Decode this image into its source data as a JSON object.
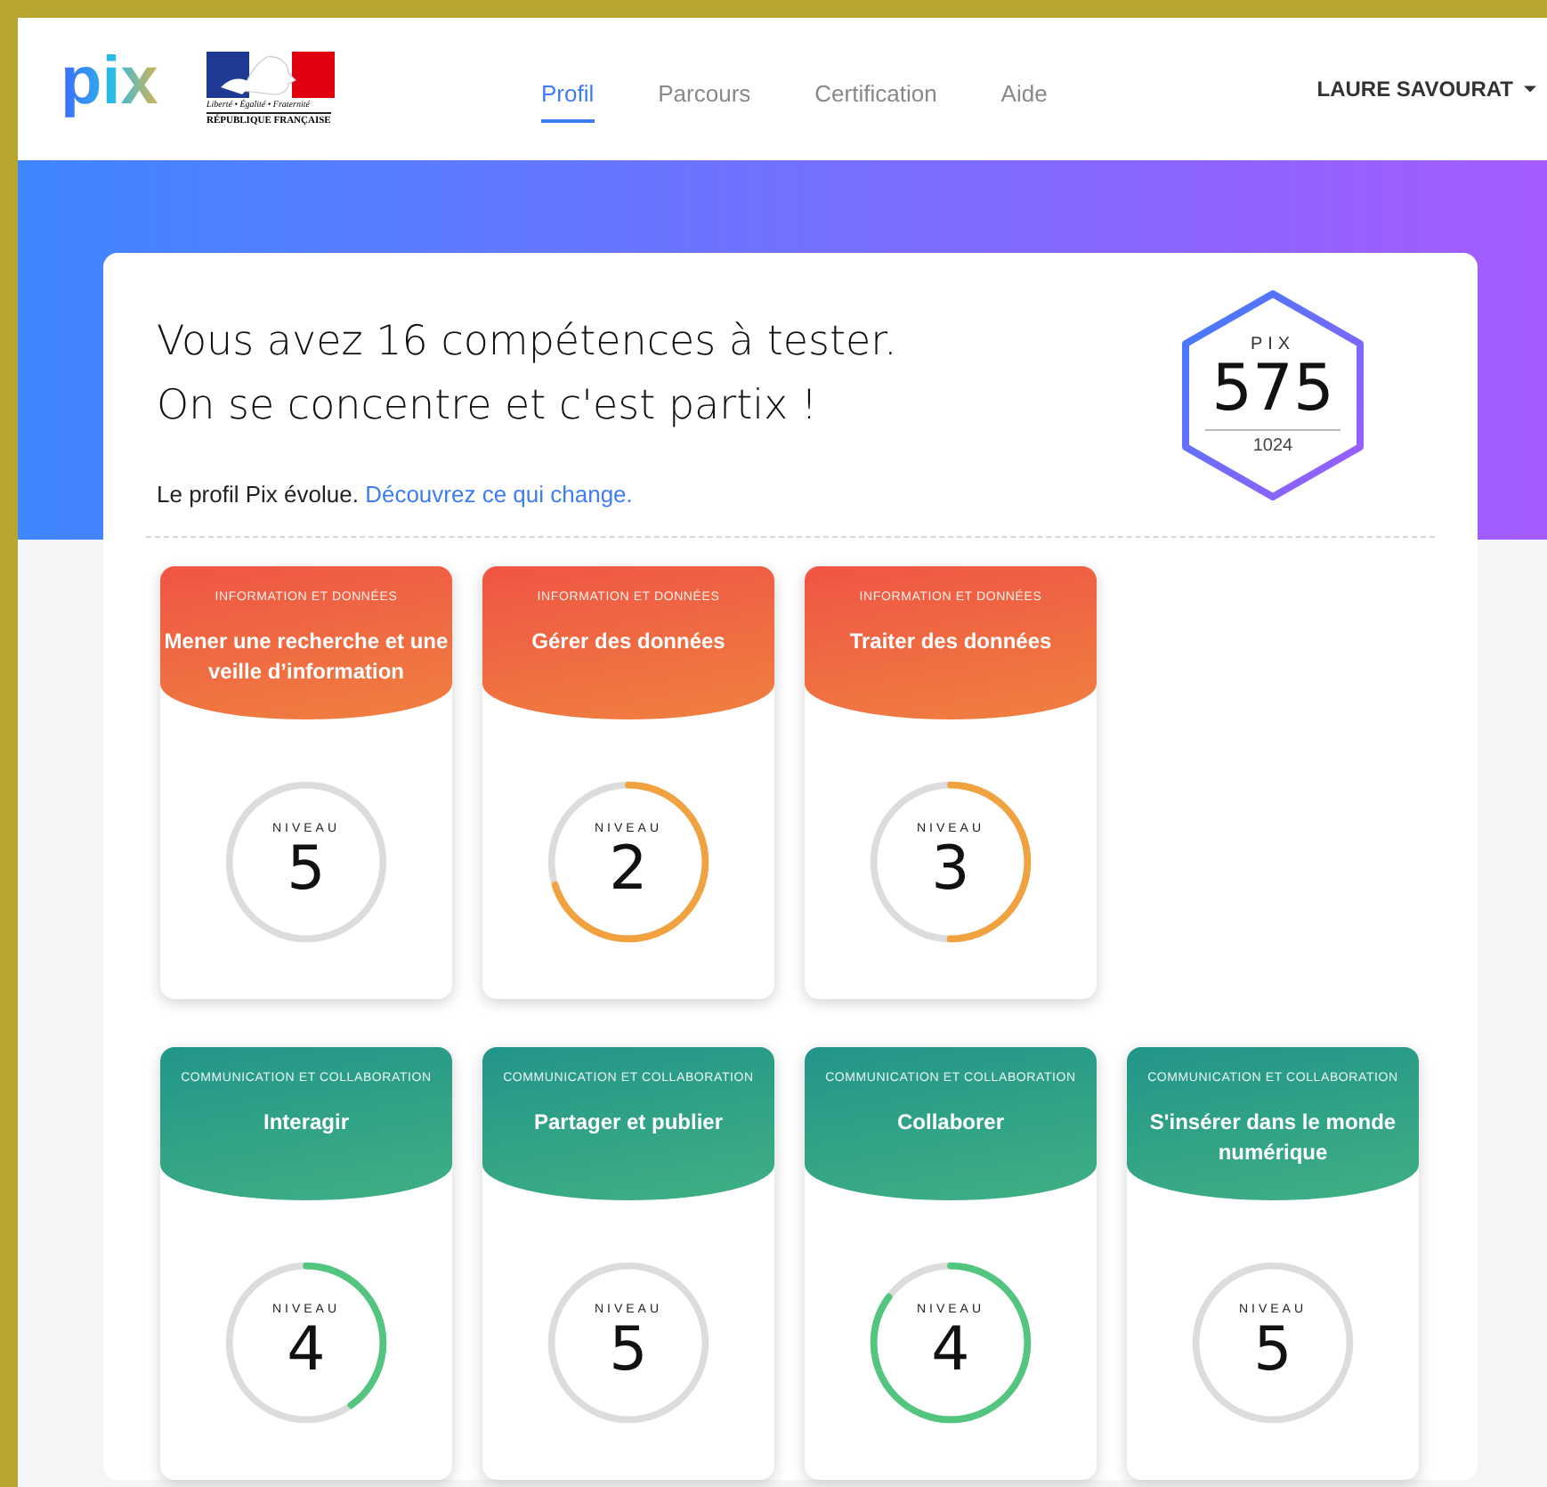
{
  "header": {
    "logo": "pix",
    "gov_logo": {
      "motto": "Liberté • Égalité • Fraternité",
      "name": "RÉPUBLIQUE FRANÇAISE"
    },
    "tabs": [
      {
        "label": "Profil",
        "selected": true
      },
      {
        "label": "Parcours",
        "selected": false
      },
      {
        "label": "Certification",
        "selected": false
      },
      {
        "label": "Aide",
        "selected": false
      }
    ],
    "user": "LAURE SAVOURAT"
  },
  "intro": {
    "title_lines": [
      "Vous avez 16 compétences à tester.",
      "On se concentre et c'est partix !"
    ],
    "note": "Le profil Pix évolue.",
    "link": "Découvrez ce qui change.",
    "score": {
      "label": "PIX",
      "value": "575",
      "max": "1024"
    }
  },
  "rows": [
    {
      "cards": [
        {
          "kind": "information",
          "area": "INFORMATION ET DONNÉES",
          "name": "Mener une recherche et une veille d’information",
          "level_label": "NIVEAU",
          "niveau": "5",
          "level": 0
        },
        {
          "kind": "information",
          "area": "INFORMATION ET DONNÉES",
          "name": "Gérer des données",
          "level_label": "NIVEAU",
          "niveau": "2",
          "level": 0.7
        },
        {
          "kind": "information",
          "area": "INFORMATION ET DONNÉES",
          "name": "Traiter des données",
          "level_label": "NIVEAU",
          "niveau": "3",
          "level": 0.5
        }
      ]
    },
    {
      "cards": [
        {
          "kind": "communication",
          "area": "COMMUNICATION ET COLLABORATION",
          "name": "Interagir",
          "level_label": "NIVEAU",
          "niveau": "4",
          "level": 0.4
        },
        {
          "kind": "communication",
          "area": "COMMUNICATION ET COLLABORATION",
          "name": "Partager et publier",
          "level_label": "NIVEAU",
          "niveau": "5",
          "level": 0
        },
        {
          "kind": "communication",
          "area": "COMMUNICATION ET COLLABORATION",
          "name": "Collaborer",
          "level_label": "NIVEAU",
          "niveau": "4",
          "level": 0.85
        },
        {
          "kind": "communication",
          "area": "COMMUNICATION ET COLLABORATION",
          "name": "S'insérer dans le monde numérique",
          "level_label": "NIVEAU",
          "niveau": "5",
          "level": 0
        }
      ]
    }
  ]
}
